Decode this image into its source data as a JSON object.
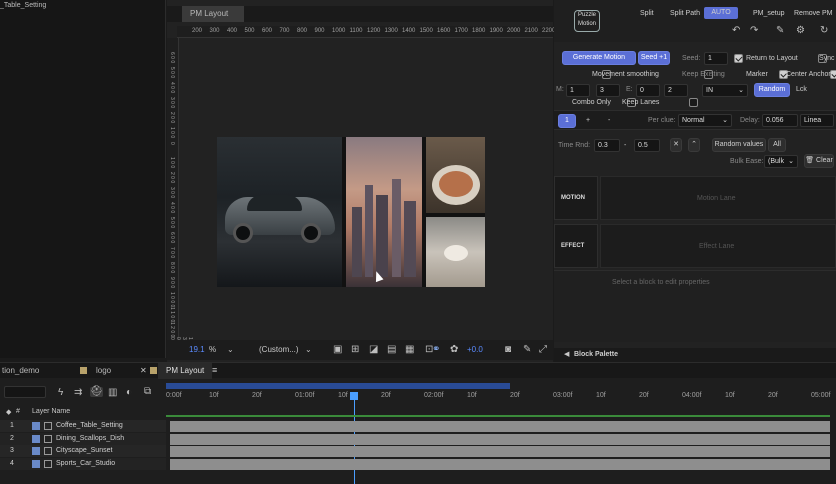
{
  "left_panel": {
    "title": "_Table_Setting"
  },
  "viewer": {
    "tab": "PM Layout",
    "ruler_h": [
      "200",
      "300",
      "400",
      "500",
      "600",
      "700",
      "800",
      "900",
      "1000",
      "1100",
      "1200",
      "1300",
      "1400",
      "1500",
      "1600",
      "1700",
      "1800",
      "1900",
      "2000",
      "2100",
      "2200"
    ],
    "ruler_v": [
      "6 0 0",
      "5 0 0",
      "4 0 0",
      "3 0 0",
      "2 0 0",
      "1 0 0",
      "0",
      "1 0 0",
      "2 0 0",
      "3 0 0",
      "4 0 0",
      "5 0 0",
      "6 0 0",
      "7 0 0",
      "8 0 0",
      "9 0 0",
      "1 0 0 0",
      "1 1 0 0",
      "1 2 0 0",
      "1 3 0 0"
    ],
    "zoom_value": "19.1",
    "zoom_unit": "%",
    "resolution": "(Custom...)",
    "exposure": "+0.0"
  },
  "plugin": {
    "logo_line1": "Puzzle",
    "logo_line2": "Motion",
    "header_buttons": [
      "Split",
      "Split Path",
      "AUTO",
      "PM_setup",
      "Remove PM"
    ],
    "generate_label": "Generate Motion",
    "seed_plus_label": "Seed +1",
    "seed_label": "Seed:",
    "seed_value": "1",
    "return_to_layout": "Return to Layout",
    "sync": "Sync",
    "movement_smoothing": "Movement smoothing",
    "keep_existing": "Keep Existing",
    "marker": "Marker",
    "center_anchor": "Center Anchor",
    "m_label": "M:",
    "m_from": "1",
    "m_to": "3",
    "e_label": "E:",
    "e_from": "0",
    "e_to": "2",
    "easing_dir": "IN",
    "random_label": "Random",
    "lock_label": "Lck",
    "combo_only": "Combo Only",
    "keep_lanes": "Keep Lanes",
    "block_num": "1",
    "plus": "+",
    "minus": "-",
    "per_clue_label": "Per clue:",
    "per_clue_value": "Normal",
    "delay_label": "Delay:",
    "delay_value": "0.056",
    "interp_value": "Linea",
    "time_rnd_label": "Time Rnd:",
    "time_from": "0.3",
    "time_dash": "-",
    "time_to": "0.5",
    "random_values": "Random values",
    "all_label": "All",
    "bulk_ease_label": "Bulk Ease:",
    "bulk_value": "(Bulk",
    "clear_label": "Clear",
    "motion_label": "MOTION",
    "motion_lane": "Motion Lane",
    "effect_label": "EFFECT",
    "effect_lane": "Effect Lane",
    "select_hint": "Select a block to edit properties",
    "block_palette": "Block Palette"
  },
  "timeline": {
    "tabs": [
      "tion_demo",
      "logo",
      "PM Layout"
    ],
    "time_labels": [
      "0:00f",
      "10f",
      "20f",
      "01:00f",
      "10f",
      "20f",
      "02:00f",
      "10f",
      "20f",
      "03:00f",
      "10f",
      "20f",
      "04:00f",
      "10f",
      "20f",
      "05:00f"
    ],
    "layer_name_header": "Layer Name",
    "layers": [
      {
        "num": "1",
        "name": "Coffee_Table_Setting"
      },
      {
        "num": "2",
        "name": "Dining_Scallops_Dish"
      },
      {
        "num": "3",
        "name": "Cityscape_Sunset"
      },
      {
        "num": "4",
        "name": "Sports_Car_Studio"
      }
    ]
  },
  "colors": {
    "accent": "#5b6fd6",
    "playhead": "#4a9eff",
    "track": "#8e8e8e",
    "work_area": "#3a8a3a"
  }
}
